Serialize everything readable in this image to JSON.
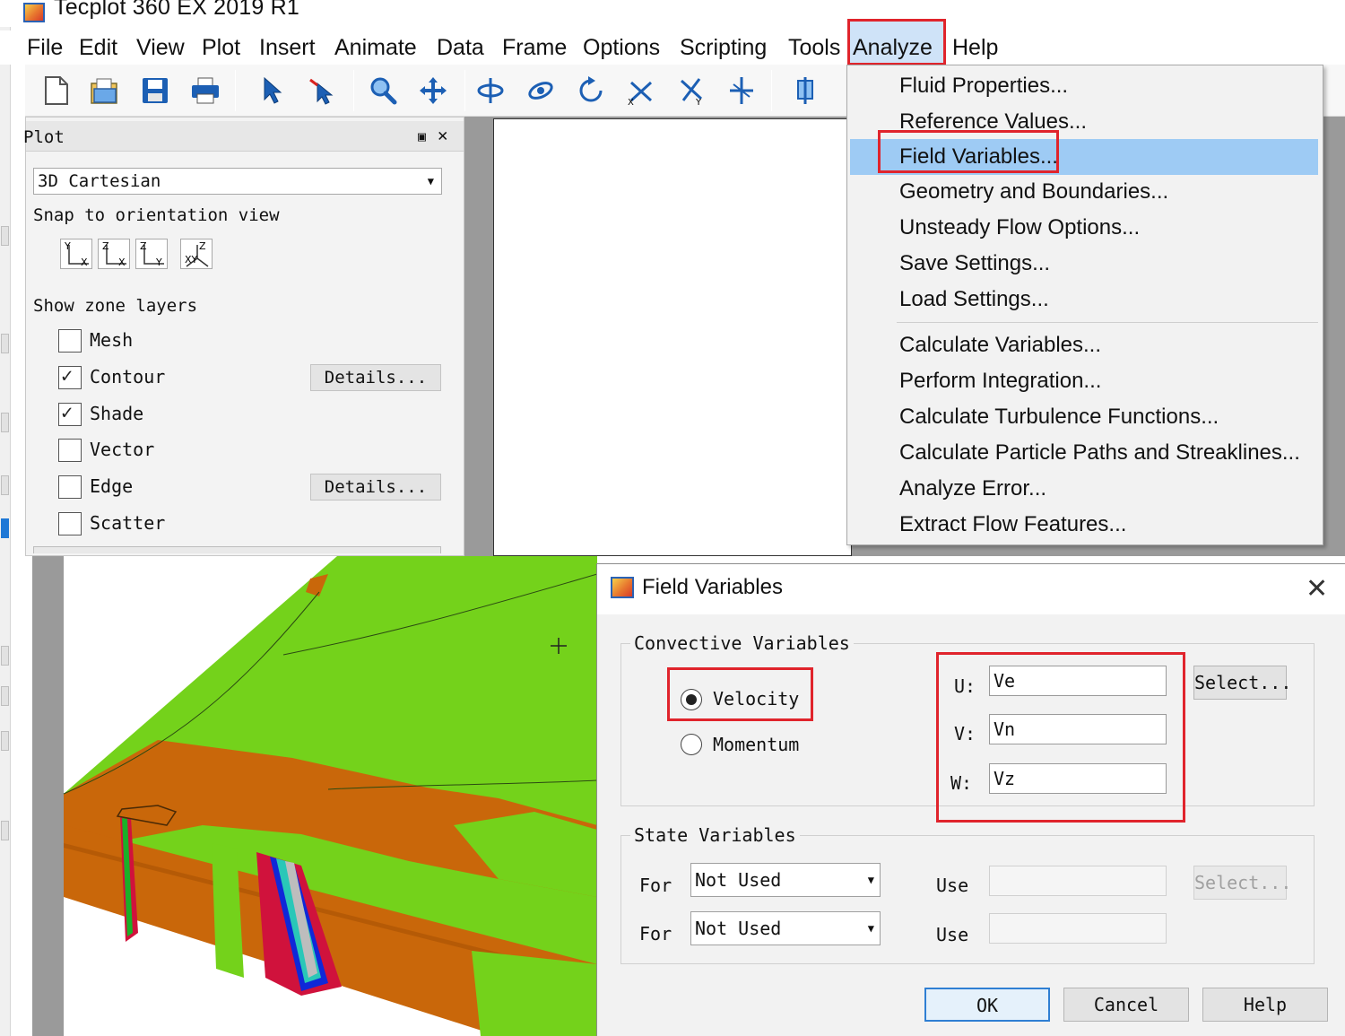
{
  "window": {
    "title": "Tecplot 360 EX 2019 R1"
  },
  "menubar": {
    "items": [
      "File",
      "Edit",
      "View",
      "Plot",
      "Insert",
      "Animate",
      "Data",
      "Frame",
      "Options",
      "Scripting",
      "Tools",
      "Analyze",
      "Help"
    ],
    "active": "Analyze"
  },
  "toolbar": {
    "icons": [
      "new-file-icon",
      "open-file-icon",
      "save-icon",
      "print-icon",
      "select-arrow-icon",
      "adjustor-icon",
      "zoom-icon",
      "translate-icon",
      "rotate-spherical-icon",
      "rotate-rollerball-icon",
      "rotate-twist-icon",
      "rotate-x-icon",
      "rotate-y-icon",
      "rotate-z-icon",
      "probe-icon"
    ]
  },
  "plot_panel": {
    "title": "Plot",
    "view_type": "3D Cartesian",
    "snap_label": "Snap to orientation view",
    "orientation_buttons": [
      {
        "top": "Y",
        "bottom": "X"
      },
      {
        "top": "Z",
        "bottom": "X"
      },
      {
        "top": "Z",
        "bottom": "Y"
      },
      {
        "top": "Z",
        "bottom": "XY"
      }
    ],
    "zone_layers_label": "Show zone layers",
    "layers": [
      {
        "label": "Mesh",
        "checked": false
      },
      {
        "label": "Contour",
        "checked": true,
        "details": "Details..."
      },
      {
        "label": "Shade",
        "checked": true
      },
      {
        "label": "Vector",
        "checked": false
      },
      {
        "label": "Edge",
        "checked": false,
        "details": "Details..."
      },
      {
        "label": "Scatter",
        "checked": false
      }
    ]
  },
  "analyze_menu": {
    "items": [
      {
        "label": "Fluid Properties..."
      },
      {
        "label": "Reference Values..."
      },
      {
        "label": "Field Variables...",
        "highlighted": true
      },
      {
        "label": "Geometry and Boundaries..."
      },
      {
        "label": "Unsteady Flow Options..."
      },
      {
        "label": "Save Settings..."
      },
      {
        "label": "Load Settings..."
      },
      {
        "label": "Calculate Variables..."
      },
      {
        "label": "Perform Integration..."
      },
      {
        "label": "Calculate Turbulence Functions..."
      },
      {
        "label": "Calculate Particle Paths and Streaklines..."
      },
      {
        "label": "Analyze Error..."
      },
      {
        "label": "Extract Flow Features..."
      }
    ]
  },
  "field_variables_dialog": {
    "title": "Field Variables",
    "convective_title": "Convective Variables",
    "options": [
      {
        "label": "Velocity",
        "selected": true
      },
      {
        "label": "Momentum",
        "selected": false
      }
    ],
    "components": [
      {
        "label": "U:",
        "value": "Ve"
      },
      {
        "label": "V:",
        "value": "Vn"
      },
      {
        "label": "W:",
        "value": "Vz"
      }
    ],
    "select_button": "Select...",
    "state_title": "State Variables",
    "state_rows": [
      {
        "for_label": "For",
        "value": "Not Used",
        "use_label": "Use",
        "use_value": ""
      },
      {
        "for_label": "For",
        "value": "Not Used",
        "use_label": "Use",
        "use_value": ""
      }
    ],
    "state_select_button": "Select...",
    "buttons": {
      "ok": "OK",
      "cancel": "Cancel",
      "help": "Help"
    }
  },
  "colors": {
    "annotation_red": "#e0242c",
    "menu_highlight": "#9ecbf4",
    "contour_green": "#74d21b",
    "contour_orange": "#c9670a"
  }
}
